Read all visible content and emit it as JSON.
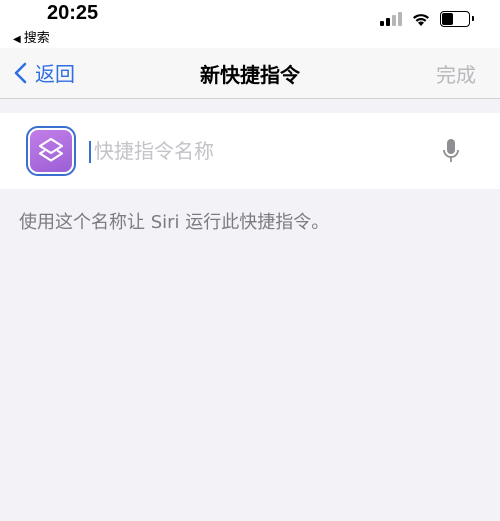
{
  "status_bar": {
    "time": "20:25",
    "back_app_label": "搜索",
    "back_app_arrow": "◀",
    "icons": [
      "cellular-signal-icon",
      "wifi-icon",
      "battery-icon"
    ]
  },
  "nav": {
    "back_label": "返回",
    "title": "新快捷指令",
    "done_label": "完成"
  },
  "name_row": {
    "value": "",
    "placeholder": "快捷指令名称",
    "icon_color": "#b06fe0"
  },
  "hint_text": "使用这个名称让 Siri 运行此快捷指令。",
  "colors": {
    "accent": "#2f6fe4",
    "disabled": "#b8b8bd",
    "background": "#f2f2f7"
  }
}
